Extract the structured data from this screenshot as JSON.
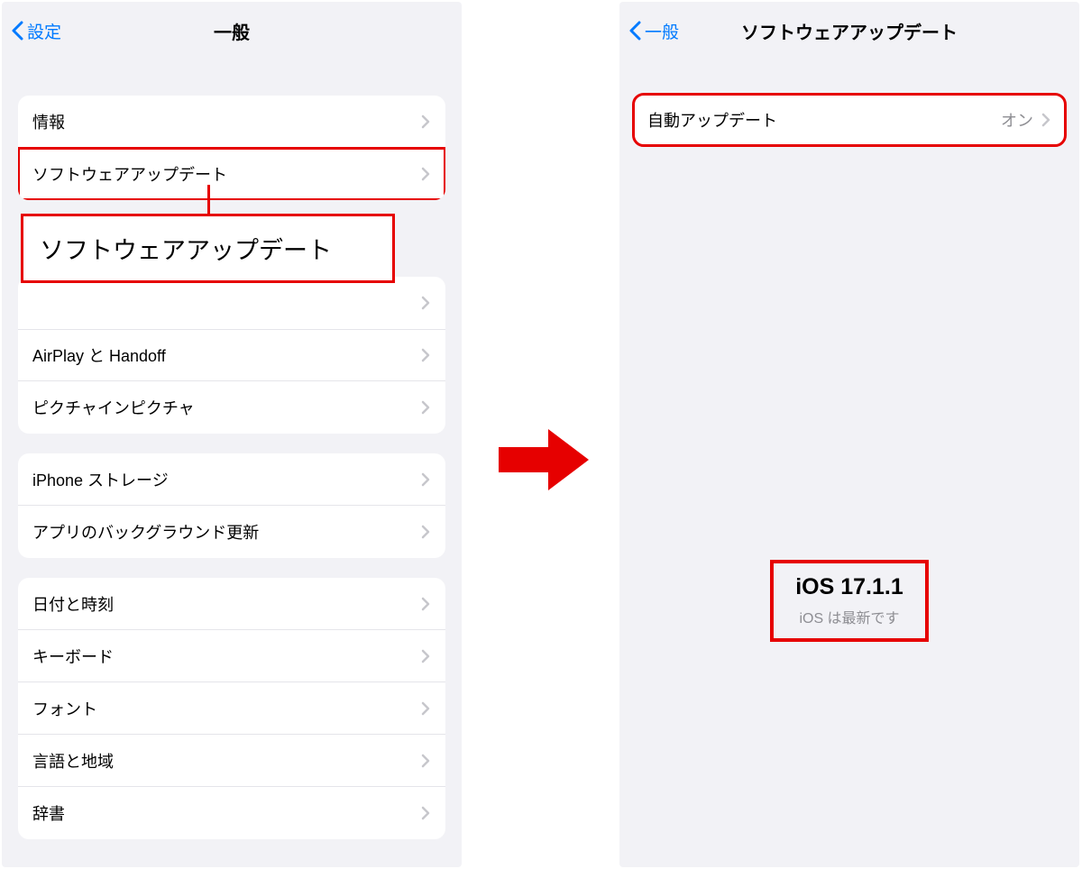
{
  "left": {
    "back_label": "設定",
    "title": "一般",
    "section1": {
      "about": "情報",
      "software_update": "ソフトウェアアップデート"
    },
    "section2": {
      "airplay_handoff": "AirPlay と Handoff",
      "pip": "ピクチャインピクチャ"
    },
    "section3": {
      "iphone_storage": "iPhone ストレージ",
      "background_app_refresh": "アプリのバックグラウンド更新"
    },
    "section4": {
      "date_time": "日付と時刻",
      "keyboard": "キーボード",
      "fonts": "フォント",
      "language_region": "言語と地域",
      "dictionary": "辞書"
    },
    "callout": "ソフトウェアアップデート"
  },
  "right": {
    "back_label": "一般",
    "title": "ソフトウェアアップデート",
    "auto_update_label": "自動アップデート",
    "auto_update_value": "オン",
    "ios_version": "iOS 17.1.1",
    "ios_status": "iOS は最新です"
  },
  "colors": {
    "accent": "#007aff",
    "highlight": "#e60000",
    "secondary_text": "#8e8e93",
    "bg": "#f2f2f6"
  }
}
